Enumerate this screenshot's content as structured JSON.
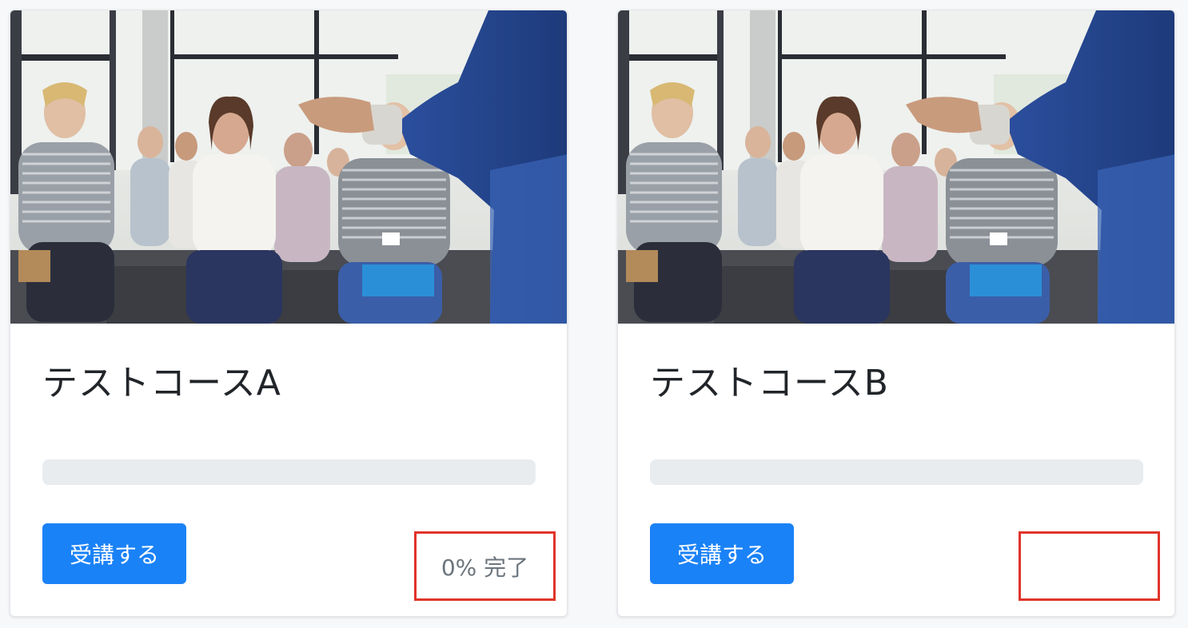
{
  "courses": [
    {
      "title": "テストコースA",
      "image_alt": "lecture-audience-photo",
      "enroll_label": "受講する",
      "progress_percent": 0,
      "status_text": "0% 完了"
    },
    {
      "title": "テストコースB",
      "image_alt": "lecture-audience-photo",
      "enroll_label": "受講する",
      "progress_percent": 0,
      "status_text": ""
    }
  ],
  "colors": {
    "accent": "#1a82f7",
    "highlight": "#e0342a",
    "progress_track": "#e9ecef",
    "muted_text": "#6c757d"
  }
}
